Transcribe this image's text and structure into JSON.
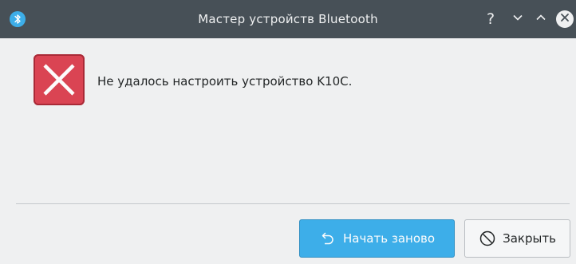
{
  "window": {
    "title": "Мастер устройств Bluetooth",
    "app_icon": "bluetooth-icon",
    "controls": {
      "help_label": "?",
      "minimize_icon": "chevron-down-icon",
      "maximize_icon": "chevron-up-icon",
      "close_icon": "close-icon"
    }
  },
  "dialog": {
    "icon": "error-icon",
    "message": "Не удалось настроить устройство K10C."
  },
  "buttons": {
    "restart": {
      "label": "Начать заново",
      "icon": "undo-icon"
    },
    "close": {
      "label": "Закрыть",
      "icon": "cancel-icon"
    }
  },
  "colors": {
    "titlebar": "#475057",
    "accent": "#3daee9",
    "error": "#da4453",
    "background": "#eff0f1"
  }
}
